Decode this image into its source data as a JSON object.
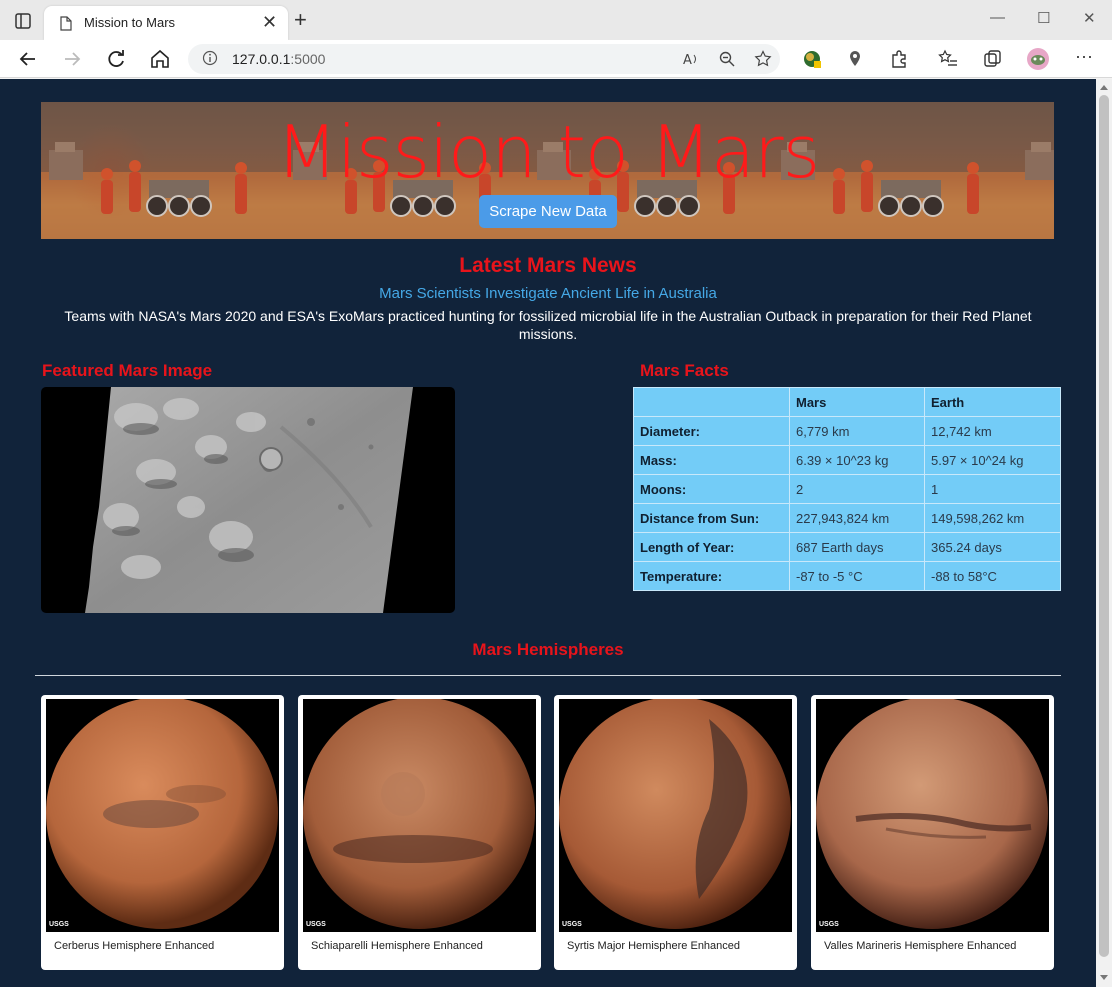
{
  "browser": {
    "tab_title": "Mission to Mars",
    "url_host": "127.0.0.1",
    "url_port": ":5000"
  },
  "banner": {
    "title": "Mission to Mars",
    "scrape_button": "Scrape New Data"
  },
  "news": {
    "heading": "Latest Mars News",
    "title": "Mars Scientists Investigate Ancient Life in Australia",
    "paragraph": "Teams with NASA's Mars 2020 and ESA's ExoMars practiced hunting for fossilized microbial life in the Australian Outback in preparation for their Red Planet missions."
  },
  "featured": {
    "heading": "Featured Mars Image"
  },
  "facts": {
    "heading": "Mars Facts",
    "columns": [
      "",
      "Mars",
      "Earth"
    ],
    "rows": [
      {
        "label": "Diameter:",
        "mars": "6,779 km",
        "earth": "12,742 km"
      },
      {
        "label": "Mass:",
        "mars": "6.39 × 10^23 kg",
        "earth": "5.97 × 10^24 kg"
      },
      {
        "label": "Moons:",
        "mars": "2",
        "earth": "1"
      },
      {
        "label": "Distance from Sun:",
        "mars": "227,943,824 km",
        "earth": "149,598,262 km"
      },
      {
        "label": "Length of Year:",
        "mars": "687 Earth days",
        "earth": "365.24 days"
      },
      {
        "label": "Temperature:",
        "mars": "-87 to -5 °C",
        "earth": "-88 to 58°C"
      }
    ]
  },
  "hemispheres": {
    "heading": "Mars Hemispheres",
    "items": [
      {
        "title": "Cerberus Hemisphere Enhanced"
      },
      {
        "title": "Schiaparelli Hemisphere Enhanced"
      },
      {
        "title": "Syrtis Major Hemisphere Enhanced"
      },
      {
        "title": "Valles Marineris Hemisphere Enhanced"
      }
    ],
    "usgs_mark": "USGS"
  },
  "colors": {
    "page_bg": "#11233a",
    "heading_red": "#e8141b",
    "news_title_blue": "#45a8e6",
    "table_bg": "#73ccf7",
    "button_blue": "#4b9be8"
  }
}
